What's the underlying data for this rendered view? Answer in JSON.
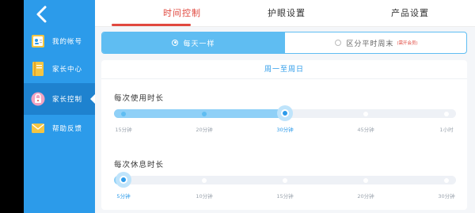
{
  "sidebar": {
    "items": [
      {
        "label": "我的帐号",
        "icon": "account-card-icon"
      },
      {
        "label": "家长中心",
        "icon": "notebook-icon"
      },
      {
        "label": "家长控制",
        "icon": "lock-icon"
      },
      {
        "label": "帮助反馈",
        "icon": "envelope-icon"
      }
    ],
    "active_index": 2
  },
  "tabs": [
    {
      "label": "时间控制",
      "active": true
    },
    {
      "label": "护眼设置",
      "active": false
    },
    {
      "label": "产品设置",
      "active": false
    }
  ],
  "mode": {
    "option_everyday": "每天一样",
    "option_split": "区分平时周末",
    "option_split_note": "(需开会员)",
    "selected": "everyday"
  },
  "card": {
    "header": "周一至周日",
    "usage": {
      "title": "每次使用时长",
      "ticks": [
        "15分钟",
        "20分钟",
        "30分钟",
        "45分钟",
        "1小时"
      ],
      "selected_index": 2
    },
    "rest": {
      "title": "每次休息时长",
      "ticks": [
        "5分钟",
        "10分钟",
        "15分钟",
        "20分钟",
        "30分钟"
      ],
      "selected_index": 0
    }
  },
  "colors": {
    "sidebar_bg": "#2c9bea",
    "accent": "#5fbdf2",
    "tab_active": "#e0483f"
  }
}
